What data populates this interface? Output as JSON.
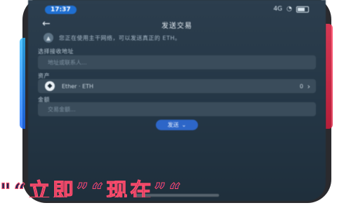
{
  "status": {
    "time": "17:37",
    "network": "4G"
  },
  "nav": {
    "title": "发送交易"
  },
  "notice": {
    "text": "您正在使用主干网络，可以发送真正的 ETH。"
  },
  "address": {
    "label": "选择接收地址",
    "placeholder": "地址或联系人..."
  },
  "asset": {
    "label": "资产",
    "name": "Ether · ETH",
    "balance": "0"
  },
  "amount": {
    "label": "金额",
    "placeholder": "交易金额..."
  },
  "send": {
    "label": "发送"
  },
  "overlay": {
    "text": "\"“立即”“现在”“"
  },
  "colors": {
    "primary": "#2d66c8",
    "background": "#243645"
  }
}
